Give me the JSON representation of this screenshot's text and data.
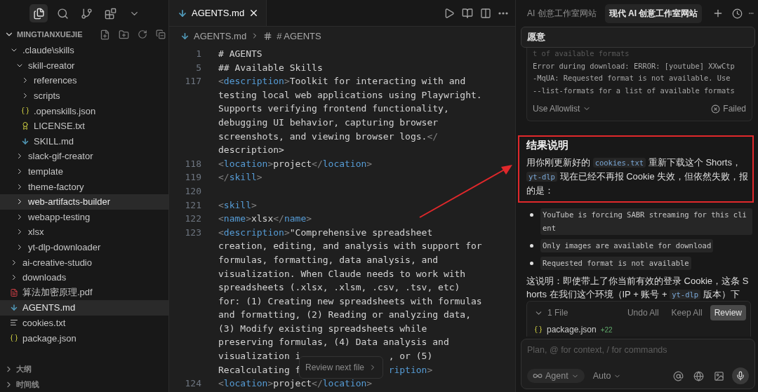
{
  "activity_bar": {
    "items": [
      {
        "kind": "files",
        "selected": true
      },
      {
        "kind": "search",
        "selected": false
      },
      {
        "kind": "source-control",
        "selected": false
      },
      {
        "kind": "extensions",
        "selected": false
      },
      {
        "kind": "more",
        "selected": false
      }
    ]
  },
  "explorer": {
    "root": {
      "label": "MINGTIANXUEJIE",
      "expanded": true
    },
    "items": [
      {
        "label": ".claude\\skills",
        "kind": "folder",
        "expanded": true,
        "selected": false,
        "children": [
          {
            "label": "skill-creator",
            "kind": "folder",
            "expanded": true,
            "selected": false,
            "children": [
              {
                "label": "references",
                "kind": "folder",
                "expanded": false,
                "selected": false
              },
              {
                "label": "scripts",
                "kind": "folder",
                "expanded": false,
                "selected": false
              },
              {
                "label": ".openskills.json",
                "kind": "json",
                "selected": false
              },
              {
                "label": "LICENSE.txt",
                "kind": "license",
                "selected": false
              },
              {
                "label": "SKILL.md",
                "kind": "markdown",
                "selected": false
              }
            ]
          },
          {
            "label": "slack-gif-creator",
            "kind": "folder",
            "expanded": false,
            "selected": false
          },
          {
            "label": "template",
            "kind": "folder",
            "expanded": false,
            "selected": false
          },
          {
            "label": "theme-factory",
            "kind": "folder",
            "expanded": false,
            "selected": false
          },
          {
            "label": "web-artifacts-builder",
            "kind": "folder",
            "expanded": false,
            "selected": true
          },
          {
            "label": "webapp-testing",
            "kind": "folder",
            "expanded": false,
            "selected": false
          },
          {
            "label": "xlsx",
            "kind": "folder",
            "expanded": false,
            "selected": false
          },
          {
            "label": "yt-dlp-downloader",
            "kind": "folder",
            "expanded": false,
            "selected": false
          }
        ]
      },
      {
        "label": "ai-creative-studio",
        "kind": "folder",
        "expanded": false,
        "selected": false
      },
      {
        "label": "downloads",
        "kind": "folder",
        "expanded": false,
        "selected": false
      },
      {
        "label": "算法加密原理.pdf",
        "kind": "pdf",
        "selected": false
      },
      {
        "label": "AGENTS.md",
        "kind": "markdown",
        "selected": true
      },
      {
        "label": "cookies.txt",
        "kind": "text",
        "selected": false
      },
      {
        "label": "package.json",
        "kind": "json",
        "selected": false
      }
    ],
    "sections": [
      {
        "label": "大纲",
        "expanded": false
      },
      {
        "label": "时间线",
        "expanded": false
      }
    ]
  },
  "editor": {
    "tab": {
      "label": "AGENTS.md",
      "selected": true
    },
    "breadcrumb": [
      "AGENTS.md",
      "# AGENTS"
    ],
    "lines": [
      {
        "number": "1",
        "rows": [
          "# AGENTS"
        ]
      },
      {
        "number": "5",
        "rows": [
          "## Available Skills"
        ]
      },
      {
        "number": "117",
        "rows": [
          "<description>Toolkit for interacting with and",
          "testing local web applications using Playwright.",
          "Supports verifying frontend functionality,",
          "debugging UI behavior, capturing browser",
          "screenshots, and viewing browser logs.</",
          "description>"
        ]
      },
      {
        "number": "118",
        "rows": [
          "<location>project</location>"
        ]
      },
      {
        "number": "119",
        "rows": [
          "</skill>"
        ]
      },
      {
        "number": "120",
        "rows": [
          ""
        ]
      },
      {
        "number": "121",
        "rows": [
          "<skill>"
        ]
      },
      {
        "number": "122",
        "rows": [
          "<name>xlsx</name>"
        ]
      },
      {
        "number": "123",
        "rows": [
          "<description>\"Comprehensive spreadsheet",
          "creation, editing, and analysis with support for",
          "formulas, formatting, data analysis, and",
          "visualization. When Claude needs to work with",
          "spreadsheets (.xlsx, .xlsm, .csv, .tsv, etc)",
          "for: (1) Creating new spreadsheets with formulas",
          "and formatting, (2) Reading or analyzing data,",
          "(3) Modify existing spreadsheets while",
          "preserving formulas, (4) Data analysis and",
          {
            "left": "visualization i",
            "right": ", or (5)",
            "right_in_tag": false
          },
          {
            "left": "Recalculating f",
            "right": "ription>",
            "right_in_tag": true
          }
        ]
      },
      {
        "number": "124",
        "rows": [
          "<location>project</location>"
        ]
      }
    ],
    "tooltip": {
      "label": "Review next file"
    }
  },
  "chat": {
    "tabs": [
      {
        "label": "AI 创意工作室网站",
        "selected": false
      },
      {
        "label": "现代 AI 创意工作室网站",
        "selected": true
      }
    ],
    "user_message": "愿意",
    "tool_card": {
      "clipped_line": "t of available formats",
      "output": [
        "Error during download: ERROR: [youtube] XXwCtp",
        "-MqUA: Requested format is not available. Use",
        "--list-formats for a list of available formats"
      ],
      "allowlist": "Use Allowlist",
      "status": "Failed"
    },
    "heading": "结果说明",
    "paragraph": [
      {
        "kind": "text",
        "text": "用你刚更新好的 "
      },
      {
        "kind": "code",
        "text": "cookies.txt"
      },
      {
        "kind": "text",
        "text": " 重新下载这个 Shorts， "
      },
      {
        "kind": "code",
        "text": "yt-dlp"
      },
      {
        "kind": "text",
        "text": " 现在已经不再报 Cookie 失效，但依然失败，报的是："
      }
    ],
    "bullets": [
      "YouTube is forcing SABR streaming for this client",
      "Only images are available for download",
      "Requested format is not available"
    ],
    "paragraph_2": [
      {
        "kind": "text",
        "text": "这说明：即使带上了你当前有效的登录 Cookie，这条 Shorts 在我们这个环境（IP + 账号 + "
      },
      {
        "kind": "code",
        "text": "yt-dlp"
      },
      {
        "kind": "text",
        "text": " 版本）下"
      }
    ],
    "changes": {
      "summary": "1 File",
      "expanded": true,
      "actions": [
        "Undo All",
        "Keep All"
      ],
      "review": "Review",
      "files": [
        {
          "name": "package.json",
          "added": "+22"
        }
      ]
    },
    "composer": {
      "placeholder": "Plan, @ for context, / for commands",
      "mode": "Agent",
      "model": "Auto"
    }
  }
}
